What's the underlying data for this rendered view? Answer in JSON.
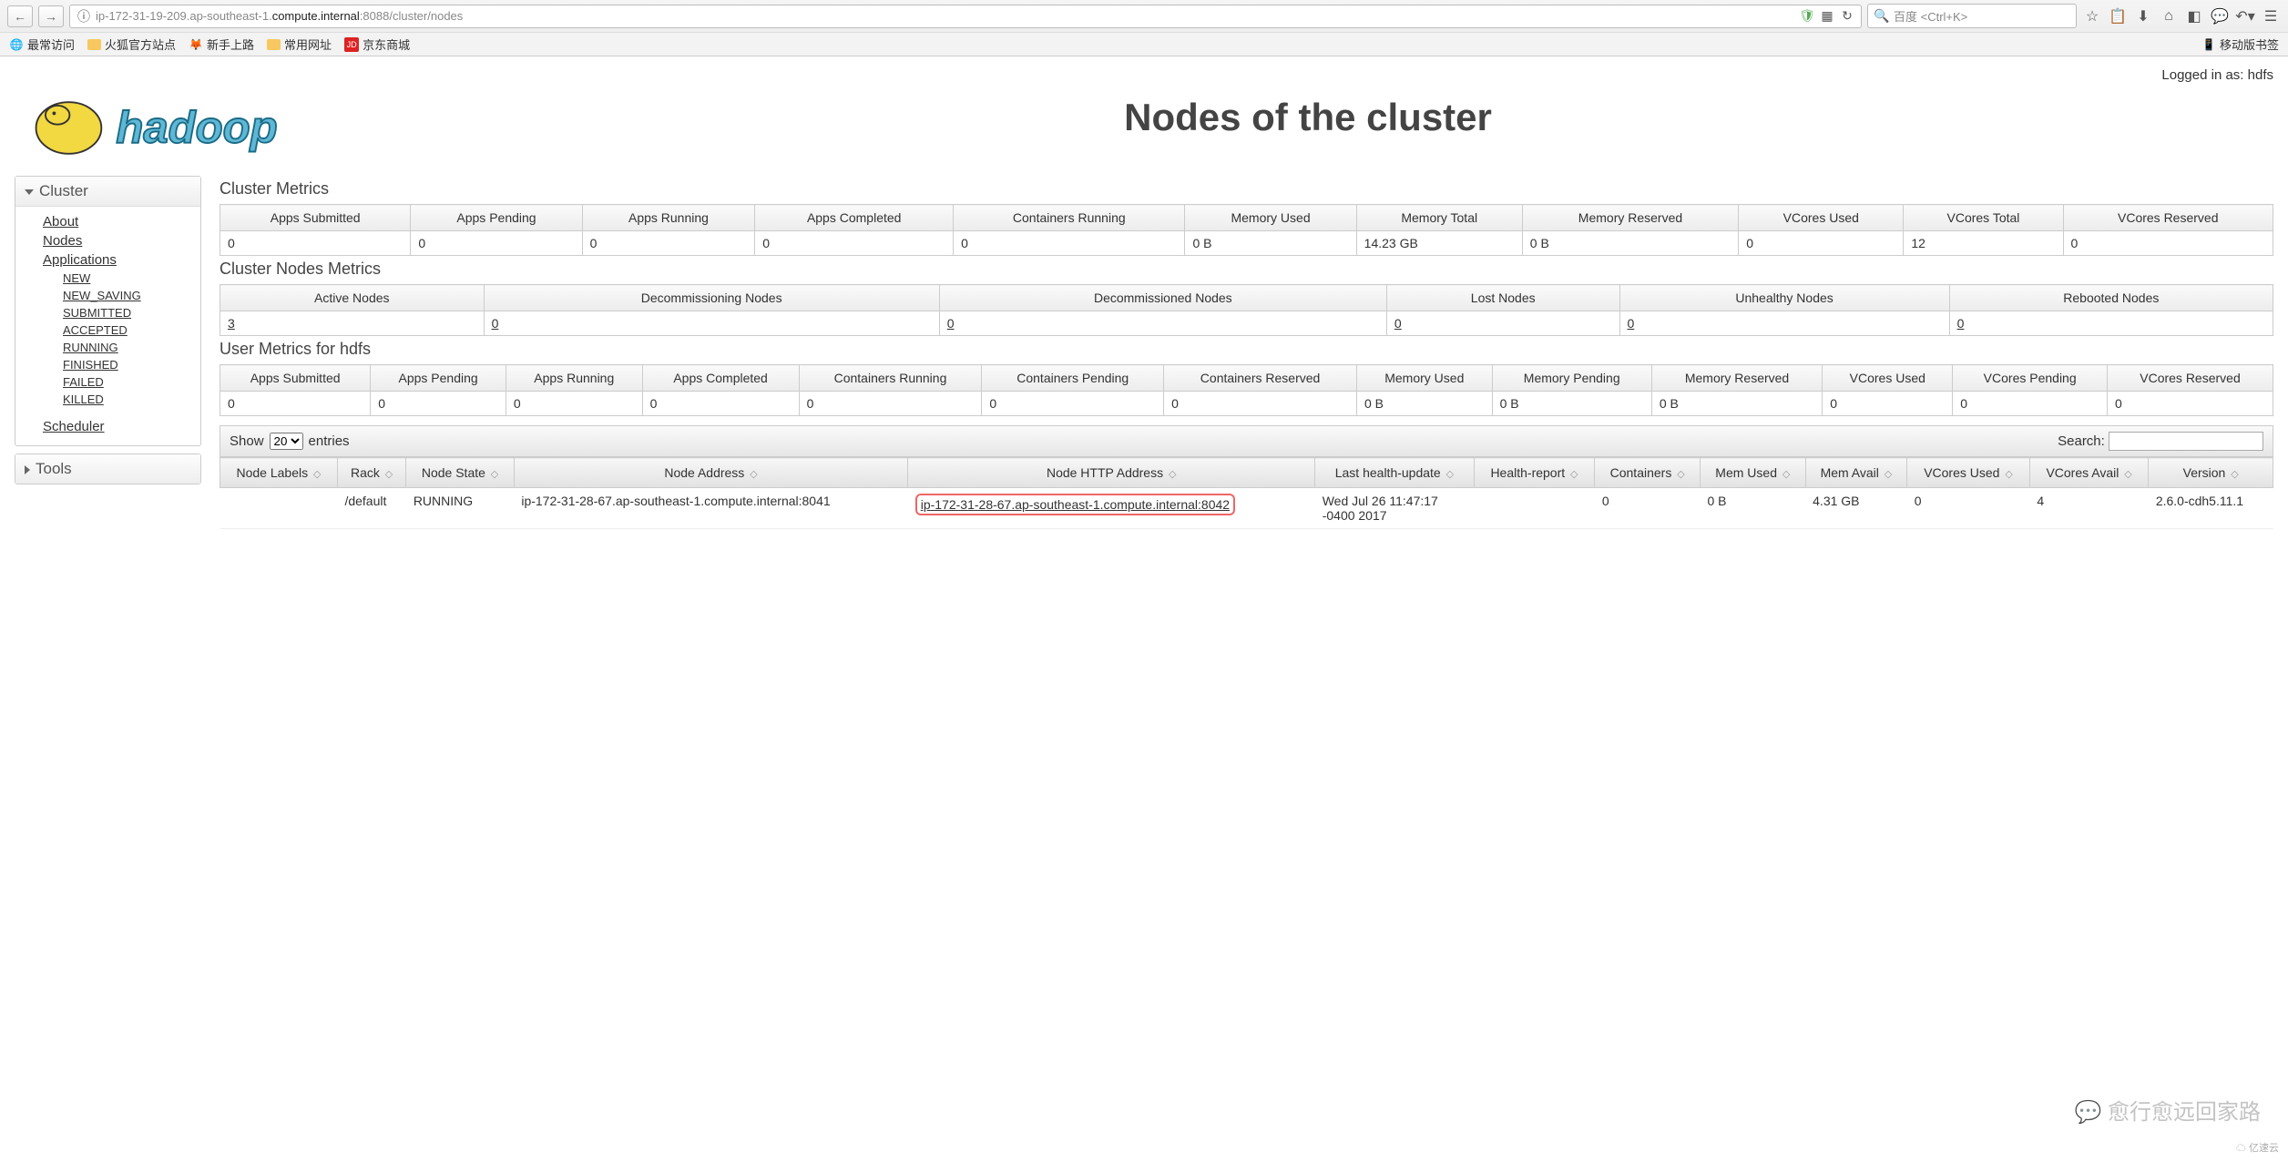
{
  "browser": {
    "url_prefix": "ip-172-31-19-209.ap-southeast-1.",
    "url_host": "compute.internal",
    "url_port_path": ":8088/cluster/nodes",
    "search_placeholder": "百度 <Ctrl+K>",
    "bookmarks": {
      "frequent": "最常访问",
      "firefox_official": "火狐官方站点",
      "getting_started": "新手上路",
      "common_urls": "常用网址",
      "jd": "京东商城",
      "mobile": "移动版书签"
    }
  },
  "page": {
    "logged_in": "Logged in as: hdfs",
    "title": "Nodes of the cluster"
  },
  "sidebar": {
    "cluster": "Cluster",
    "about": "About",
    "nodes": "Nodes",
    "applications": "Applications",
    "states": [
      "NEW",
      "NEW_SAVING",
      "SUBMITTED",
      "ACCEPTED",
      "RUNNING",
      "FINISHED",
      "FAILED",
      "KILLED"
    ],
    "scheduler": "Scheduler",
    "tools": "Tools"
  },
  "cluster_metrics": {
    "title": "Cluster Metrics",
    "headers": [
      "Apps Submitted",
      "Apps Pending",
      "Apps Running",
      "Apps Completed",
      "Containers Running",
      "Memory Used",
      "Memory Total",
      "Memory Reserved",
      "VCores Used",
      "VCores Total",
      "VCores Reserved"
    ],
    "values": [
      "0",
      "0",
      "0",
      "0",
      "0",
      "0 B",
      "14.23 GB",
      "0 B",
      "0",
      "12",
      "0"
    ]
  },
  "nodes_metrics": {
    "title": "Cluster Nodes Metrics",
    "headers": [
      "Active Nodes",
      "Decommissioning Nodes",
      "Decommissioned Nodes",
      "Lost Nodes",
      "Unhealthy Nodes",
      "Rebooted Nodes"
    ],
    "values": [
      "3",
      "0",
      "0",
      "0",
      "0",
      "0"
    ]
  },
  "user_metrics": {
    "title": "User Metrics for hdfs",
    "headers": [
      "Apps Submitted",
      "Apps Pending",
      "Apps Running",
      "Apps Completed",
      "Containers Running",
      "Containers Pending",
      "Containers Reserved",
      "Memory Used",
      "Memory Pending",
      "Memory Reserved",
      "VCores Used",
      "VCores Pending",
      "VCores Reserved"
    ],
    "values": [
      "0",
      "0",
      "0",
      "0",
      "0",
      "0",
      "0",
      "0 B",
      "0 B",
      "0 B",
      "0",
      "0",
      "0"
    ]
  },
  "datatable": {
    "show_label": "Show",
    "entries_label": "entries",
    "show_value": "20",
    "search_label": "Search:",
    "headers": [
      "Node Labels",
      "Rack",
      "Node State",
      "Node Address",
      "Node HTTP Address",
      "Last health-update",
      "Health-report",
      "Containers",
      "Mem Used",
      "Mem Avail",
      "VCores Used",
      "VCores Avail",
      "Version"
    ],
    "row": {
      "labels": "",
      "rack": "/default",
      "state": "RUNNING",
      "address": "ip-172-31-28-67.ap-southeast-1.compute.internal:8041",
      "http_address": "ip-172-31-28-67.ap-southeast-1.compute.internal:8042",
      "last_update": "Wed Jul 26 11:47:17 -0400 2017",
      "health": "",
      "containers": "0",
      "mem_used": "0 B",
      "mem_avail": "4.31 GB",
      "vcores_used": "0",
      "vcores_avail": "4",
      "version": "2.6.0-cdh5.11.1"
    }
  },
  "watermark": "愈行愈远回家路",
  "watermark2": "亿速云"
}
